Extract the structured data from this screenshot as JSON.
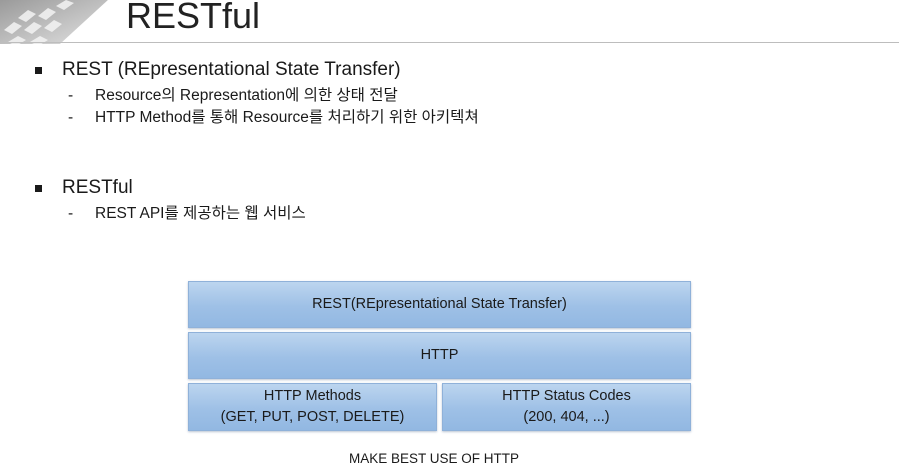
{
  "slide": {
    "title": "RESTful"
  },
  "bullets": [
    {
      "text": "REST (REpresentational State Transfer)",
      "sub": [
        "Resource의 Representation에 의한 상태 전달",
        "HTTP Method를 통해 Resource를 처리하기 위한 아키텍쳐"
      ]
    },
    {
      "text": "RESTful",
      "sub": [
        "REST API를 제공하는 웹 서비스"
      ]
    }
  ],
  "sub_marker": "-",
  "diagram": {
    "top": "REST(REpresentational State Transfer)",
    "middle": "HTTP",
    "left": {
      "line1": "HTTP Methods",
      "line2": "(GET, PUT, POST, DELETE)"
    },
    "right": {
      "line1": "HTTP Status Codes",
      "line2": "(200, 404, ...)"
    },
    "caption": "MAKE BEST USE OF HTTP"
  },
  "colors": {
    "block_fill": "#9ec0e6",
    "block_border": "#8fb1d9",
    "title_rule": "#bdbdbd"
  }
}
